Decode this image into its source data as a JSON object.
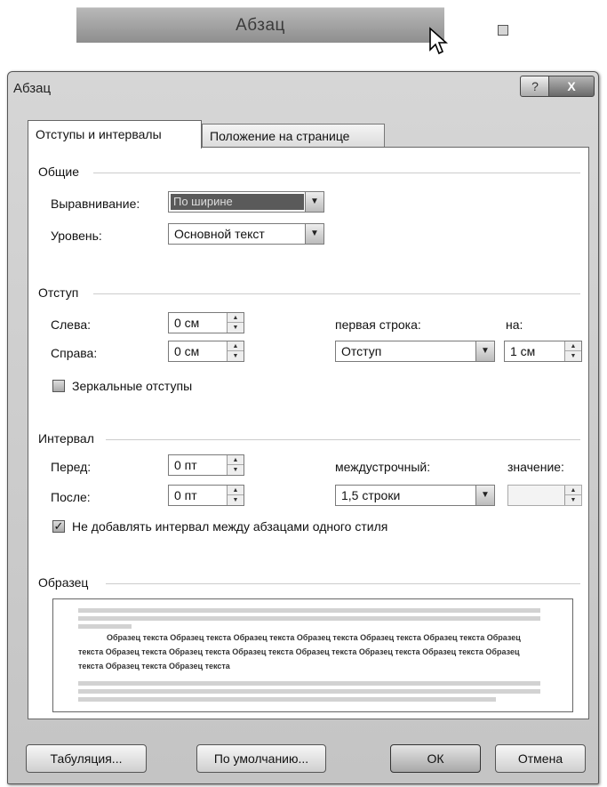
{
  "ribbon": {
    "group_label": "Абзац"
  },
  "dialog": {
    "title": "Абзац",
    "help_label": "?",
    "close_label": "X",
    "tabs": [
      {
        "label": "Отступы и интервалы",
        "active": true
      },
      {
        "label": "Положение на странице",
        "active": false
      }
    ],
    "general": {
      "heading": "Общие",
      "alignment_label": "Выравнивание:",
      "alignment_value": "По ширине",
      "level_label": "Уровень:",
      "level_value": "Основной текст"
    },
    "indent": {
      "heading": "Отступ",
      "left_label": "Слева:",
      "left_value": "0 см",
      "right_label": "Справа:",
      "right_value": "0 см",
      "first_line_label": "первая строка:",
      "first_line_value": "Отступ",
      "by_label": "на:",
      "by_value": "1 см",
      "mirror_label": "Зеркальные отступы",
      "mirror_checked": false
    },
    "spacing": {
      "heading": "Интервал",
      "before_label": "Перед:",
      "before_value": "0 пт",
      "after_label": "После:",
      "after_value": "0 пт",
      "line_label": "междустрочный:",
      "line_value": "1,5 строки",
      "value_label": "значение:",
      "value_value": "",
      "no_space_label": "Не добавлять интервал между абзацами одного стиля",
      "no_space_checked": true
    },
    "preview": {
      "heading": "Образец",
      "sample_lines": [
        "Образец текста Образец текста Образец текста Образец текста Образец текста Образец текста Образец",
        "текста Образец текста Образец текста Образец текста Образец текста Образец текста Образец текста Образец",
        "текста Образец текста Образец текста"
      ]
    },
    "buttons": {
      "tabs_label": "Табуляция...",
      "default_label": "По умолчанию...",
      "ok_label": "ОК",
      "cancel_label": "Отмена"
    }
  }
}
